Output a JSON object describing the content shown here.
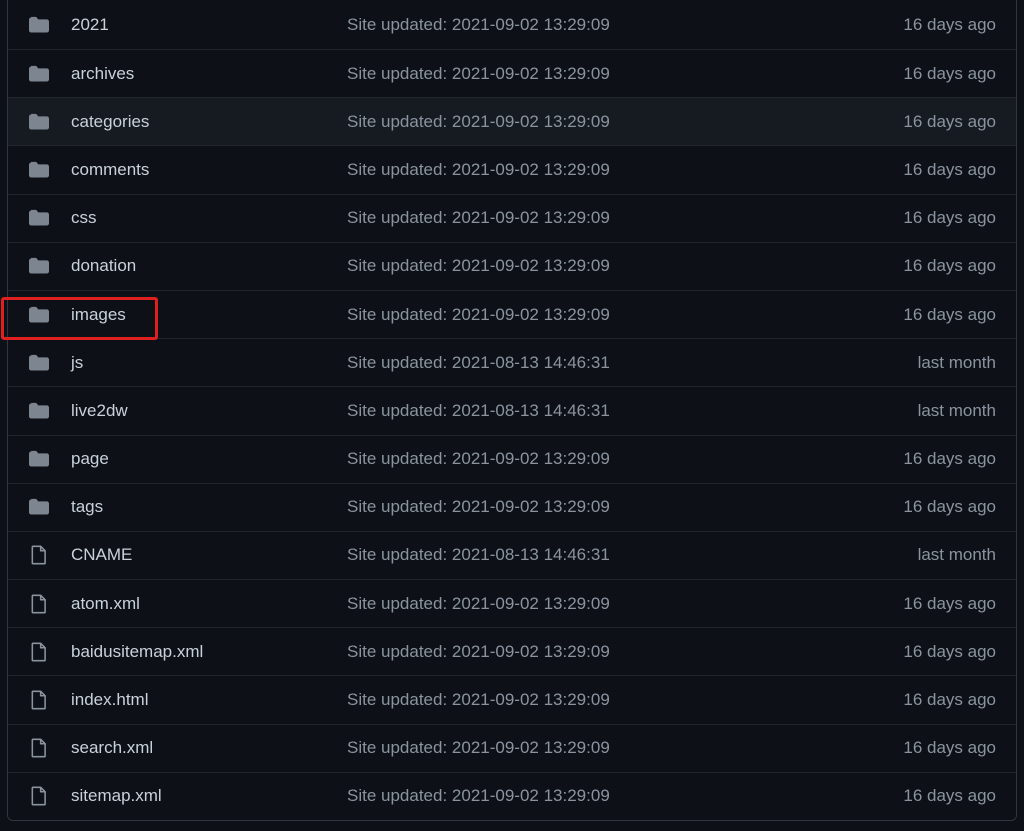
{
  "colors": {
    "background": "#0d1117",
    "row_hover": "#161b22",
    "border": "#30363d",
    "name_text": "#c9d1d9",
    "muted_text": "#8b949e",
    "folder_icon": "#7d8590",
    "highlight": "#e0201e"
  },
  "files": [
    {
      "type": "folder",
      "icon": "folder-icon",
      "name": "2021",
      "message": "Site updated: 2021-09-02 13:29:09",
      "age": "16 days ago"
    },
    {
      "type": "folder",
      "icon": "folder-icon",
      "name": "archives",
      "message": "Site updated: 2021-09-02 13:29:09",
      "age": "16 days ago"
    },
    {
      "type": "folder",
      "icon": "folder-icon",
      "name": "categories",
      "message": "Site updated: 2021-09-02 13:29:09",
      "age": "16 days ago"
    },
    {
      "type": "folder",
      "icon": "folder-icon",
      "name": "comments",
      "message": "Site updated: 2021-09-02 13:29:09",
      "age": "16 days ago"
    },
    {
      "type": "folder",
      "icon": "folder-icon",
      "name": "css",
      "message": "Site updated: 2021-09-02 13:29:09",
      "age": "16 days ago"
    },
    {
      "type": "folder",
      "icon": "folder-icon",
      "name": "donation",
      "message": "Site updated: 2021-09-02 13:29:09",
      "age": "16 days ago"
    },
    {
      "type": "folder",
      "icon": "folder-icon",
      "name": "images",
      "message": "Site updated: 2021-09-02 13:29:09",
      "age": "16 days ago"
    },
    {
      "type": "folder",
      "icon": "folder-icon",
      "name": "js",
      "message": "Site updated: 2021-08-13 14:46:31",
      "age": "last month"
    },
    {
      "type": "folder",
      "icon": "folder-icon",
      "name": "live2dw",
      "message": "Site updated: 2021-08-13 14:46:31",
      "age": "last month"
    },
    {
      "type": "folder",
      "icon": "folder-icon",
      "name": "page",
      "message": "Site updated: 2021-09-02 13:29:09",
      "age": "16 days ago"
    },
    {
      "type": "folder",
      "icon": "folder-icon",
      "name": "tags",
      "message": "Site updated: 2021-09-02 13:29:09",
      "age": "16 days ago"
    },
    {
      "type": "file",
      "icon": "file-icon",
      "name": "CNAME",
      "message": "Site updated: 2021-08-13 14:46:31",
      "age": "last month"
    },
    {
      "type": "file",
      "icon": "file-icon",
      "name": "atom.xml",
      "message": "Site updated: 2021-09-02 13:29:09",
      "age": "16 days ago"
    },
    {
      "type": "file",
      "icon": "file-icon",
      "name": "baidusitemap.xml",
      "message": "Site updated: 2021-09-02 13:29:09",
      "age": "16 days ago"
    },
    {
      "type": "file",
      "icon": "file-icon",
      "name": "index.html",
      "message": "Site updated: 2021-09-02 13:29:09",
      "age": "16 days ago"
    },
    {
      "type": "file",
      "icon": "file-icon",
      "name": "search.xml",
      "message": "Site updated: 2021-09-02 13:29:09",
      "age": "16 days ago"
    },
    {
      "type": "file",
      "icon": "file-icon",
      "name": "sitemap.xml",
      "message": "Site updated: 2021-09-02 13:29:09",
      "age": "16 days ago"
    }
  ],
  "hovered_row": "categories",
  "highlighted_row": "images"
}
